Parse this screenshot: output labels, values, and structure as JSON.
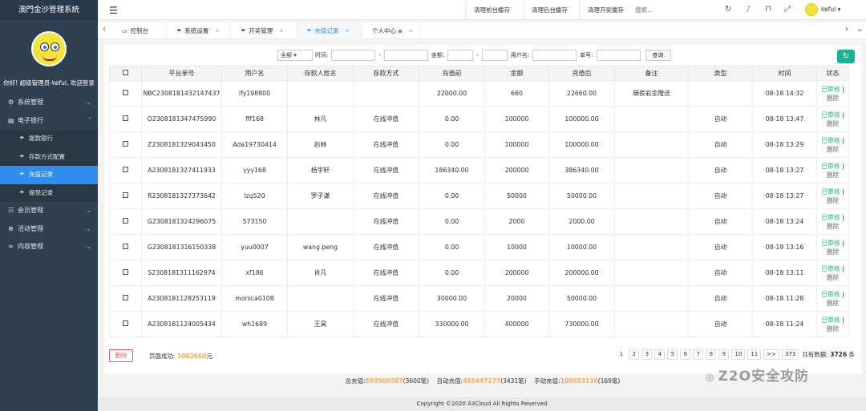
{
  "brand": "澳門金沙管理系統",
  "welcome": "你好! 超级管理员-keful, 欢迎登录",
  "menu": {
    "system": "系统管理",
    "ebank": "电子银行",
    "sub": [
      "提款银行",
      "存款方式配置",
      "充值记录",
      "提现记录"
    ],
    "member": "会员管理",
    "activity": "活动管理",
    "content": "内容管理"
  },
  "topbar": {
    "cache_front": "清理前台缓存",
    "cache_back": "清理后台缓存",
    "cache_lottery": "清理开奖缓存",
    "search_placeholder": "搜索...",
    "user": "keful"
  },
  "tabs": [
    "控制台",
    "系统设置",
    "开奖管理",
    "充值记录",
    "个人中心"
  ],
  "filter": {
    "select": "全部",
    "time_label": "时间:",
    "dash": "-",
    "amount_label": "金额:",
    "user_label": "用户名:",
    "order_label": "单号:",
    "query": "查询"
  },
  "table": {
    "headers": [
      "平台单号",
      "用户名",
      "存款人姓名",
      "存款方式",
      "充值前",
      "金额",
      "充值后",
      "备注",
      "类型",
      "时间",
      "状态"
    ],
    "rows": [
      {
        "order": "NBC2308181432147437",
        "user": "lfy198800",
        "depositor": "",
        "method": "",
        "before": "22000.00",
        "amount": "660",
        "after": "22660.00",
        "note": "隔夜彩金赠送",
        "type": "",
        "time": "08-18 14:32"
      },
      {
        "order": "O2308181347475990",
        "user": "fff168",
        "depositor": "林凡",
        "method": "在线冲值",
        "before": "0.00",
        "amount": "100000",
        "after": "100000.00",
        "note": "",
        "type": "自动",
        "time": "08-18 13:47"
      },
      {
        "order": "Z2308181329043450",
        "user": "Ada19730414",
        "depositor": "赵林",
        "method": "在线冲值",
        "before": "0.00",
        "amount": "100000",
        "after": "100000.00",
        "note": "",
        "type": "自动",
        "time": "08-18 13:29"
      },
      {
        "order": "A2308181327411933",
        "user": "yyy168",
        "depositor": "杨宇轩",
        "method": "在线冲值",
        "before": "186340.00",
        "amount": "200000",
        "after": "386340.00",
        "note": "",
        "type": "自动",
        "time": "08-18 13:27"
      },
      {
        "order": "R2308181327373642",
        "user": "lzq520",
        "depositor": "罗子谦",
        "method": "在线冲值",
        "before": "0.00",
        "amount": "50000",
        "after": "50000.00",
        "note": "",
        "type": "自动",
        "time": "08-18 13:27"
      },
      {
        "order": "G2308181324296075",
        "user": "573150",
        "depositor": "",
        "method": "在线冲值",
        "before": "0.00",
        "amount": "2000",
        "after": "2000.00",
        "note": "",
        "type": "自动",
        "time": "08-18 13:24"
      },
      {
        "order": "G2308181316150338",
        "user": "yuu0007",
        "depositor": "wang peng",
        "method": "在线冲值",
        "before": "0.00",
        "amount": "10000",
        "after": "10000.00",
        "note": "",
        "type": "自动",
        "time": "08-18 13:16"
      },
      {
        "order": "S2308181311162974",
        "user": "xf186",
        "depositor": "肖凡",
        "method": "在线冲值",
        "before": "0.00",
        "amount": "200000",
        "after": "200000.00",
        "note": "",
        "type": "自动",
        "time": "08-18 13:11"
      },
      {
        "order": "A2308181128253119",
        "user": "monica0108",
        "depositor": "",
        "method": "在线冲值",
        "before": "30000.00",
        "amount": "20000",
        "after": "50000.00",
        "note": "",
        "type": "自动",
        "time": "08-18 11:28"
      },
      {
        "order": "A2308181124005434",
        "user": "wh1689",
        "depositor": "王昊",
        "method": "在线冲值",
        "before": "330000.00",
        "amount": "400000",
        "after": "730000.00",
        "note": "",
        "type": "自动",
        "time": "08-18 11:24"
      }
    ],
    "status_ok": "已审核",
    "status_sep": "|",
    "status_delete": "删除"
  },
  "bottom": {
    "delete_btn": "删除",
    "page_success_label": "页面成功:",
    "page_success_value": "1082660",
    "page_success_unit": "元",
    "pages": [
      "1",
      "2",
      "3",
      "4",
      "5",
      "6",
      "7",
      "8",
      "9",
      "10",
      "11",
      ">>",
      "373"
    ],
    "total_label": "共有数据:",
    "total_value": "3726",
    "total_unit": "条"
  },
  "totals": {
    "total_label": "总充值:",
    "total_value": "593500387",
    "total_count": "(3600笔)",
    "auto_label": "自动充值:",
    "auto_value": "485447277",
    "auto_count": "(3431笔)",
    "manual_label": "手动充值:",
    "manual_value": "108053110",
    "manual_count": "(169笔)"
  },
  "footer": "Copyright ©2020 A3Cloud All Rights Reserved",
  "watermark": "Z2O安全攻防",
  "colors": {
    "sidebar": "#2f4050",
    "active": "#2e8ded",
    "green": "#1ab394",
    "orange": "#f8ac59",
    "red": "#ed5565"
  }
}
